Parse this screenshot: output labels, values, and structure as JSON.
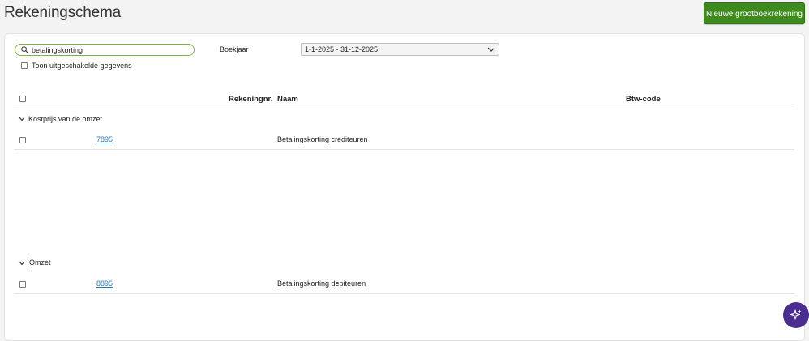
{
  "header": {
    "title": "Rekeningschema",
    "new_button_label": "Nieuwe grootboekrekening"
  },
  "filters": {
    "search_value": "betalingskorting",
    "show_disabled_label": "Toon uitgeschakelde gegevens",
    "year_label": "Boekjaar",
    "year_value": "1-1-2025 - 31-12-2025"
  },
  "table": {
    "columns": {
      "account_number": "Rekeningnr.",
      "name": "Naam",
      "vat_code": "Btw-code"
    },
    "groups": [
      {
        "label": "Kostprijs van de omzet",
        "rows": [
          {
            "number": "7895",
            "name": "Betalingskorting crediteuren",
            "vat": ""
          }
        ]
      },
      {
        "label": "Omzet",
        "rows": [
          {
            "number": "8895",
            "name": "Betalingskorting debiteuren",
            "vat": ""
          }
        ]
      }
    ]
  },
  "icons": {
    "search": "search-icon",
    "dropdown": "chevron-down-icon",
    "collapse": "chevron-down-icon",
    "assistant": "sparkle-icon"
  },
  "colors": {
    "primary_button": "#3f8a1e",
    "link": "#2a77b8",
    "search_border": "#7ab43e",
    "assistant_button": "#4b2c8f"
  }
}
